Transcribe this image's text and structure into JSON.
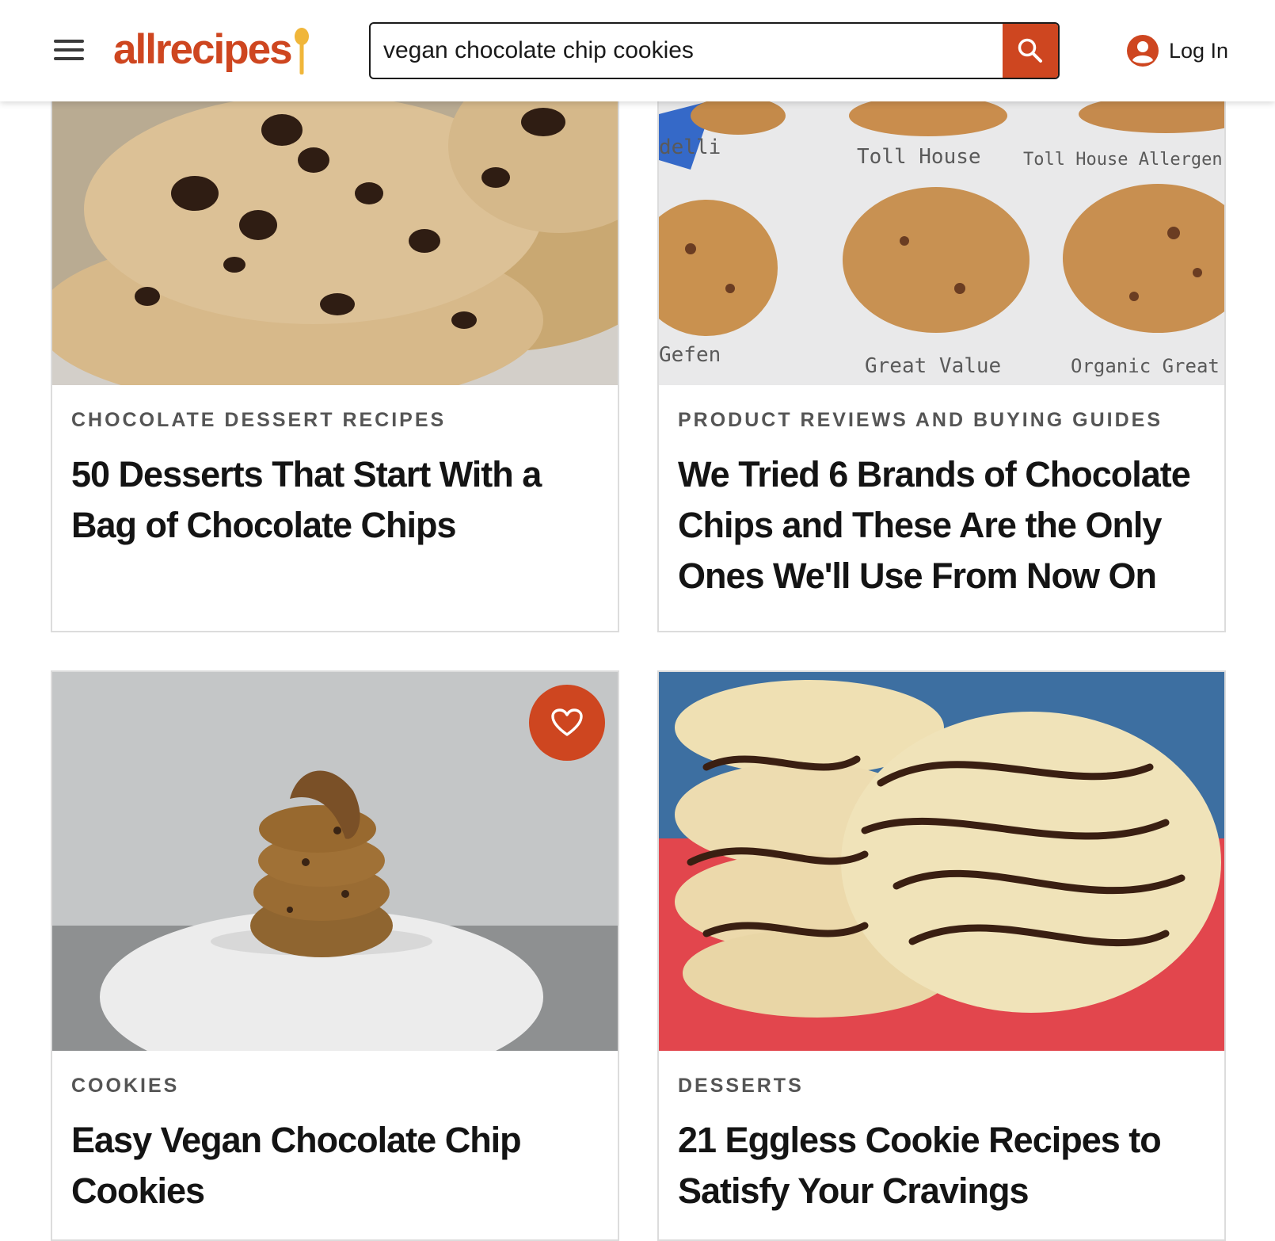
{
  "header": {
    "logo_text": "allrecipes",
    "search_value": "vegan chocolate chip cookies",
    "search_icon": "search-icon",
    "menu_icon": "hamburger-menu-icon",
    "login_label": "Log In",
    "account_icon": "user-account-icon"
  },
  "colors": {
    "brand": "#ce4620",
    "text": "#141414",
    "tag": "#555555",
    "border": "#dcdcdc"
  },
  "cards": [
    {
      "tag": "Chocolate Dessert Recipes",
      "title": "50 Desserts That Start With a Bag of Chocolate Chips",
      "image_desc": "stacked chocolate chip cookies"
    },
    {
      "tag": "Product Reviews and Buying Guides",
      "title": "We Tried 6 Brands of Chocolate Chips and These Are the Only Ones We'll Use From Now On",
      "image_labels": [
        "delli",
        "Toll House",
        "Toll House Allergen",
        "Gefen",
        "Great Value",
        "Organic Great V"
      ]
    },
    {
      "tag": "Cookies",
      "title": "Easy Vegan Chocolate Chip Cookies",
      "save_icon": "heart-icon"
    },
    {
      "tag": "Desserts",
      "title": "21 Eggless Cookie Recipes to Satisfy Your Cravings",
      "image_desc": "cookies drizzled with chocolate on red cloth"
    }
  ]
}
